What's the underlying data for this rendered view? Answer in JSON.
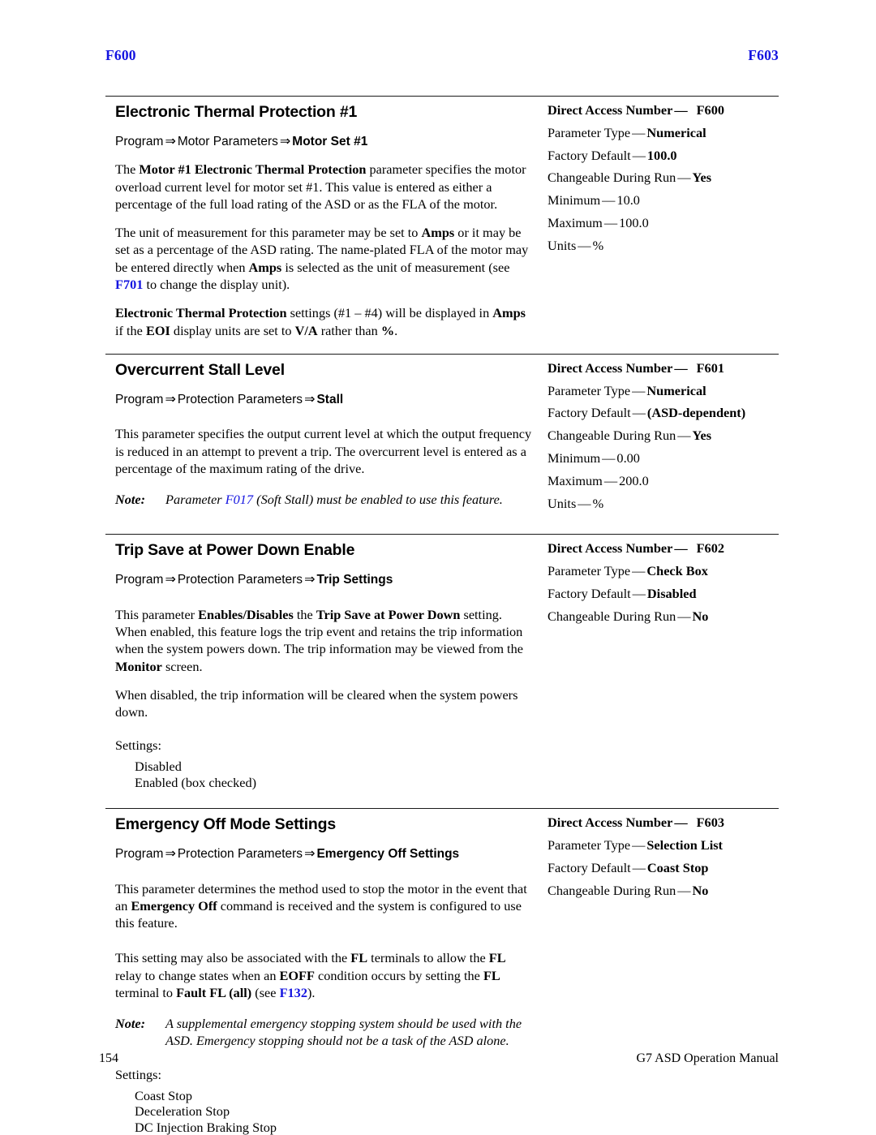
{
  "running_head": {
    "left": "F600",
    "right": "F603",
    "link_color": "#1414e0"
  },
  "footer": {
    "page_number": "154",
    "manual_title": "G7 ASD Operation Manual"
  },
  "sections": [
    {
      "title": "Electronic Thermal Protection #1",
      "nav": {
        "root": "Program",
        "middle": "Motor Parameters",
        "last": "Motor Set #1",
        "arrow": "⇒"
      },
      "paragraphs": [
        "The Motor #1 Electronic Thermal Protection parameter specifies the motor overload current level for motor set #1. This value is entered as either a percentage of the full load rating of the ASD or as the FLA of the motor.",
        "The unit of measurement for this parameter may be set to Amps or it may be set as a percentage of the ASD rating. The name-plated FLA of the motor may be entered directly when Amps is selected as the unit of measurement (see F701 to change the display unit).",
        "Electronic Thermal Protection settings (#1 – #4) will be displayed in Amps if the EOI display units are set to V/A rather than %."
      ],
      "spec": {
        "direct_access_label": "Direct Access Number",
        "direct_access_value": "F600",
        "rows": [
          {
            "key": "Parameter Type",
            "value": "Numerical",
            "bold": true
          },
          {
            "key": "Factory Default",
            "value": "100.0",
            "bold": true
          },
          {
            "key": "Changeable During Run",
            "value": "Yes",
            "bold": true
          },
          {
            "key": "Minimum",
            "value": "10.0",
            "bold": false
          },
          {
            "key": "Maximum",
            "value": "100.0",
            "bold": false
          },
          {
            "key": "Units",
            "value": "%",
            "bold": false
          }
        ]
      }
    },
    {
      "title": "Overcurrent Stall Level",
      "nav": {
        "root": "Program",
        "middle": "Protection Parameters",
        "last": "Stall",
        "arrow": "⇒"
      },
      "paragraphs": [
        "This parameter specifies the output current level at which the output frequency is reduced in an attempt to prevent a trip. The overcurrent level is entered as a percentage of the maximum rating of the drive."
      ],
      "note": {
        "label": "Note:",
        "text_before": "Parameter ",
        "link": "F017",
        "text_after": " (Soft Stall) must be enabled to use this feature."
      },
      "spec": {
        "direct_access_label": "Direct Access Number",
        "direct_access_value": "F601",
        "rows": [
          {
            "key": "Parameter Type",
            "value": "Numerical",
            "bold": true
          },
          {
            "key": "Factory Default",
            "value": "(ASD-dependent)",
            "bold": true
          },
          {
            "key": "Changeable During Run",
            "value": "Yes",
            "bold": true
          },
          {
            "key": "Minimum",
            "value": "0.00",
            "bold": false
          },
          {
            "key": "Maximum",
            "value": "200.0",
            "bold": false
          },
          {
            "key": "Units",
            "value": "%",
            "bold": false
          }
        ]
      }
    },
    {
      "title": "Trip Save at Power Down Enable",
      "nav": {
        "root": "Program",
        "middle": "Protection Parameters",
        "last": "Trip Settings",
        "arrow": "⇒"
      },
      "paragraphs": [
        "This parameter Enables/Disables the Trip Save at Power Down setting. When enabled, this feature logs the trip event and retains the trip information when the system powers down. The trip information may be viewed from the Monitor screen.",
        "When disabled, the trip information will be cleared when the system powers down."
      ],
      "settings_label": "Settings:",
      "settings_items": [
        "Disabled",
        "Enabled (box checked)"
      ],
      "spec": {
        "direct_access_label": "Direct Access Number",
        "direct_access_value": "F602",
        "rows": [
          {
            "key": "Parameter Type",
            "value": "Check Box",
            "bold": true
          },
          {
            "key": "Factory Default",
            "value": "Disabled",
            "bold": true
          },
          {
            "key": "Changeable During Run",
            "value": "No",
            "bold": true
          }
        ]
      }
    },
    {
      "title": "Emergency Off Mode Settings",
      "nav": {
        "root": "Program",
        "middle": "Protection Parameters",
        "last": "Emergency Off Settings",
        "arrow": "⇒"
      },
      "paragraphs": [
        "This parameter determines the method used to stop the motor in the event that an Emergency Off command is received and the system is configured to use this feature.",
        "This setting may also be associated with the FL terminals to allow the FL relay to change states when an EOFF condition occurs by setting the FL terminal to Fault FL (all) (see F132)."
      ],
      "note": {
        "label": "Note:",
        "text": "A supplemental emergency stopping system should be used with the ASD. Emergency stopping should not be a task of the ASD alone."
      },
      "settings_label": "Settings:",
      "settings_items": [
        "Coast Stop",
        "Deceleration Stop",
        "DC Injection Braking Stop"
      ],
      "spec": {
        "direct_access_label": "Direct Access Number",
        "direct_access_value": "F603",
        "rows": [
          {
            "key": "Parameter Type",
            "value": "Selection List",
            "bold": true
          },
          {
            "key": "Factory Default",
            "value": "Coast Stop",
            "bold": true
          },
          {
            "key": "Changeable During Run",
            "value": "No",
            "bold": true
          }
        ]
      }
    }
  ]
}
